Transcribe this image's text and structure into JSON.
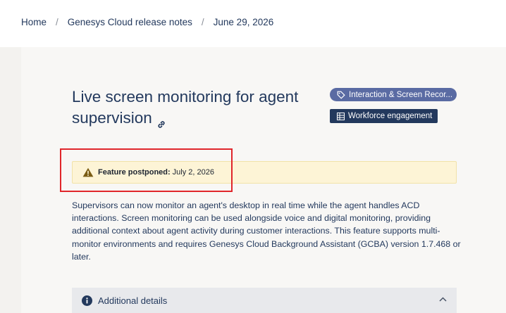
{
  "breadcrumb": {
    "home": "Home",
    "section": "Genesys Cloud release notes",
    "current": "June 29, 2026",
    "separator": "/"
  },
  "article": {
    "title": "Live screen monitoring for agent supervision",
    "tags": {
      "topic": "Interaction & Screen Recor...",
      "group": "Workforce engagement"
    },
    "notice": {
      "label": "Feature postponed:",
      "value": "July 2, 2026"
    },
    "body": "Supervisors can now monitor an agent's desktop in real time while the agent handles ACD interactions. Screen monitoring can be used alongside voice and digital monitoring, providing additional context about agent activity during customer interactions. This feature supports multi-monitor environments and requires Genesys Cloud Background Assistant (GCBA) version 1.7.468 or later.",
    "accordion_label": "Additional details"
  },
  "colors": {
    "text": "#23395d",
    "topic_tag": "#5a6ba3",
    "group_tag": "#23395d",
    "notice_bg": "#fdf4d6",
    "highlight": "#e0262b"
  },
  "icons": {
    "title_link": "link-icon",
    "topic_tag": "tag-icon",
    "group_tag": "grid-icon",
    "notice": "warning-icon",
    "accordion": "info-icon",
    "accordion_toggle": "chevron-up-icon"
  }
}
